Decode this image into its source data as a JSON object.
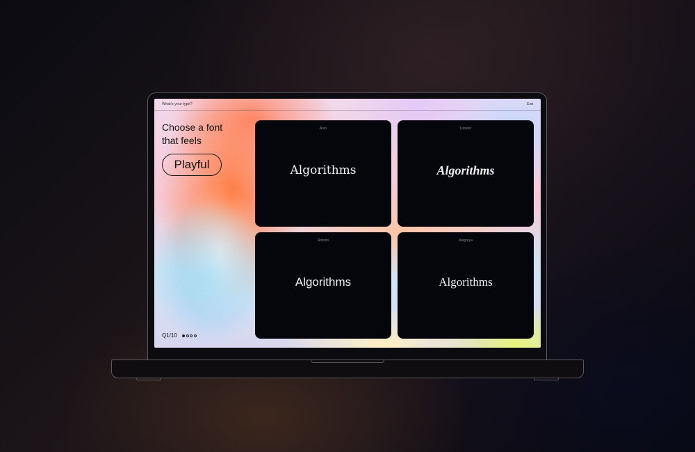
{
  "topbar": {
    "title": "What's your type?",
    "exit_label": "Exit"
  },
  "question": {
    "line1": "Choose a font",
    "line2": "that feels",
    "keyword": "Playful"
  },
  "progress": {
    "label": "Q1/10",
    "dots_total": 4,
    "dots_active": 1
  },
  "cards": [
    {
      "font": "Arvo",
      "sample": "Algorithms"
    },
    {
      "font": "Lobster",
      "sample": "Algorithms"
    },
    {
      "font": "Roboto",
      "sample": "Algorithms"
    },
    {
      "font": "Alegreya",
      "sample": "Algorithms"
    }
  ],
  "colors": {
    "card_bg": "#05060c",
    "sample_text": "#f2f2f2",
    "gradient_accent": "#ff7a3d"
  }
}
